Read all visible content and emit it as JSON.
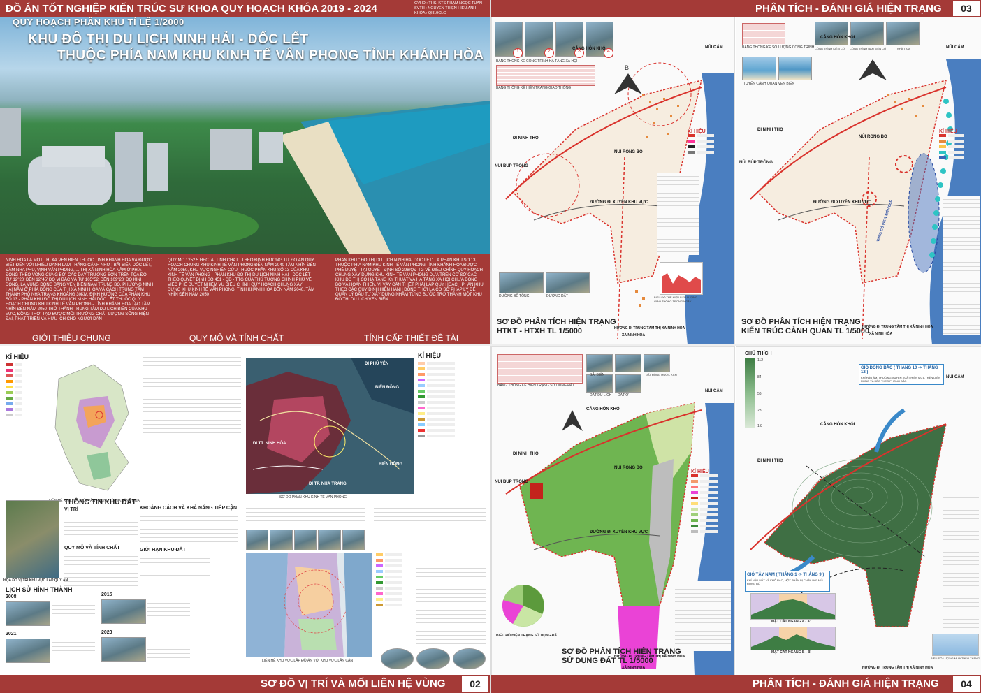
{
  "header": {
    "project_title": "ĐỒ ÁN TỐT NGHIỆP KIẾN TRÚC SƯ KHOA QUY HOẠCH KHÓA 2019 - 2024",
    "gvhd": "GVHD : THS. KTS PHẠM NGỌC TUẤN",
    "svth": "SVTH : NGUYỄN THIỆN HIẾU ANH",
    "khoa": "KHÓA : QH19CLC"
  },
  "sheet01": {
    "subtitle": "QUY HOẠCH PHÂN KHU TỈ LỆ 1/2000",
    "title_line1": "KHU ĐÔ THỊ DU LỊCH NINH HẢI - DỐC LẾT",
    "title_line2": "THUỘC PHÍA NAM KHU KINH TẾ VÂN PHONG TỈNH KHÁNH HÒA",
    "col1_text": "NINH HÒA LÀ MỘT THỊ XÃ VEN BIỂN THUỘC TỈNH KHÁNH HÒA VÀ ĐƯỢC BIẾT ĐẾN VỚI NHIỀU DANH LAM THẮNG CẢNH NHƯ : BÃI BIỂN DỐC LẾT, ĐẦM NHA PHU, VỊNH VÂN PHONG, ... THỊ XÃ NINH HÒA NẰM Ở PHÍA ĐÔNG THEO VÒNG CUNG BỞI CÁC DÃY TRƯỜNG SƠN TRÊN TỌA ĐỘ TỪ 12°20' ĐẾN 12°45' ĐỘ VĨ BẮC VÀ TỪ 105°52' ĐẾN 109°20' ĐỘ KINH ĐÔNG, LÀ VÙNG ĐỒNG BẰNG VEN BIỂN NAM TRUNG BỘ. PHƯỜNG NINH HẢI NẰM Ở PHÍA ĐÔNG CỦA THỊ XÃ NINH HÒA VÀ CÁCH TRUNG TÂM THÀNH PHỐ NHA TRANG KHOẢNG 30KM. ĐỊNH HƯỚNG CỦA PHÂN KHU SỐ 13 - PHÂN KHU ĐÔ THỊ DU LỊCH NINH HẢI DỐC LẾT THUỘC QUY HOẠCH CHUNG KHU KINH TẾ VÂN PHONG - TỈNH KHÁNH HÒA TẠO TẦM NHÌN ĐẾN NĂM 2050 TRỞ THÀNH TRUNG TÂM DU LỊCH BIỂN CỦA KHU VỰC, ĐỒNG THỜI TẠO ĐƯỢC MÔI TRƯỜNG CHẤT LƯỢNG SỐNG HIỆN ĐẠI, PHÁT TRIỂN VÀ HỮU ÍCH CHO NGƯỜI DÂN",
    "col2_text": "QUY MÔ : 252.5 HECTA. TÍNH CHẤT : THEO ĐỊNH HƯỚNG TỪ ĐỒ ÁN QUY HOẠCH CHUNG KHU KINH TẾ VÂN PHONG ĐẾN NĂM 2040 TẦM NHÌN ĐẾN NĂM 2050, KHU VỰC NGHIÊN CỨU THUỘC PHÂN KHU SỐ 13 CỦA KHU KINH TẾ VÂN PHONG - PHÂN KHU ĐÔ THỊ DU LỊCH NINH HẢI - DỐC LẾT THEO QUYẾT ĐỊNH SỐ 451 - QĐ - TTG CỦA THỦ TƯỚNG CHÍNH PHỦ VỀ VIỆC PHÊ DUYỆT NHIỆM VỤ ĐIỀU CHỈNH QUY HOẠCH CHUNG XÂY DỰNG KHU KINH TẾ VÂN PHONG, TỈNH KHÁNH HÒA ĐẾN NĂM 2040, TẦM NHÌN ĐẾN NĂM 2050",
    "col3_text": "PHÂN KHU \" ĐÔ THỊ DU LỊCH NINH HẢI DỐC LẾT\" LÀ PHÂN KHU SỐ 13 THUỘC PHÍA NAM KHU KINH TẾ VÂN PHONG TỈNH KHÁNH HÒA ĐƯỢC PHÊ DUYỆT TẠI QUYẾT ĐỊNH SỐ 298/QĐ-TG VỀ ĐIỀU CHỈNH QUY HOẠCH CHUNG XÂY DỰNG KHU KINH TẾ VÂN PHONG DỰA TRÊN CƠ SỞ CÁC KHU ĐÔ THỊ CÓ HẠ TẦNG KỸ THUẬT VÀ HẠ TẦNG XÃ HỘI CHƯA ĐỒNG BỘ VÀ HOÀN THIỆN, VÌ VẬY CẦN THIẾT PHẢI LẬP QUY HOẠCH PHÂN KHU THEO CÁC QUY ĐỊNH HIỆN HÀNH ĐỒNG THỜI LÀ CƠ SỞ PHÁP LÝ ĐỂ QUẢN LÝ ĐẦU TƯ XÂY DỰNG NHẰM TỪNG BƯỚC TRỞ THÀNH MỘT KHU ĐÔ THỊ DU LỊCH VEN BIỂN.",
    "label1": "GIỚI THIỆU CHUNG",
    "label2": "QUY MÔ VÀ TÍNH CHẤT",
    "label3": "TÍNH CẤP THIẾT ĐỀ TÀI"
  },
  "sheet02": {
    "footer_title": "SƠ ĐỒ VỊ TRÍ VÀ MỐI LIÊN HỆ VÙNG",
    "number": "02",
    "ki_hieu": "KÍ HIỆU",
    "caption_map1": "LIÊN HỆ KHU VỰC VỚI VÂN PHONG TỈNH KHÁNH HÒA",
    "caption_map2": "SƠ ĐỒ PHÂN KHU KINH TẾ VÂN PHONG",
    "caption_map3": "LIÊN HỆ KHU VỰC LẬP ĐỒ ÁN VỚI KHU VỰC LÂN CẬN",
    "thong_tin": "THÔNG TIN KHU ĐẤT",
    "vi_tri": "VỊ TRÍ",
    "quy_mo": "QUY MÔ VÀ TÍNH CHẤT",
    "khoang_cach": "KHOẢNG CÁCH VÀ KHẢ NĂNG TIẾP CẬN",
    "gioi_han": "GIỚI HẠN KHU ĐẤT",
    "hoa_do": "HỌA ĐỒ VỊ TRÍ KHU VỰC LẬP QUY ÁN",
    "lich_su": "LỊCH SỬ HÌNH THÀNH",
    "years": [
      "2008",
      "2015",
      "2021",
      "2023"
    ],
    "map_labels": [
      "ĐI PHÚ YÊN",
      "BIỂN ĐÔNG",
      "BIỂN ĐÔNG",
      "ĐI TT. NINH HÒA",
      "ĐI TP. NHA TRANG"
    ],
    "legend_ki_hieu2": "KÍ HIỆU"
  },
  "sheet03": {
    "header_title": "PHÂN TÍCH - ĐÁNH GIÁ HIỆN TRẠNG",
    "number": "03",
    "map1_title_l1": "SƠ ĐỒ PHÂN TÍCH HIỆN TRẠNG",
    "map1_title_l2": "HTKT - HTXH TL 1/5000",
    "map2_title_l1": "SƠ ĐỒ PHÂN TÍCH HIỆN TRẠNG",
    "map2_title_l2": "KIẾN TRÚC CẢNH QUAN TL 1/5000",
    "ki_hieu": "KÍ HIỆU",
    "labels": {
      "cang_hon_khoi": "CẢNG HÒN KHÓI",
      "nui_cam": "NÚI CẤM",
      "nui_rong_bo": "NÚI RONG BO",
      "di_ninh_tho": "ĐI NINH THỌ",
      "nui_bup_trong": "NÚI BÚP TRÒNG",
      "duong_di_xuyen": "ĐƯỜNG ĐI XUYÊN KHU VỰC",
      "huong_tt": "HƯỚNG ĐI TRUNG TÂM THỊ XÃ NINH HÒA",
      "xa_ninh_hoa": "XÃ NINH HÒA",
      "duong_be_tong": "ĐƯỜNG BÊ TÔNG",
      "duong_dat": "ĐƯỜNG ĐẤT",
      "vung_co_view": "VÙNG CÓ VIEW BIỂN ĐẸP",
      "tuyen_canh_quan": "TUYẾN CẢNH QUAN VEN BIỂN",
      "cong_trinh_kien_co": "CÔNG TRÌNH KIÊN CỐ",
      "cong_trinh_ban_kien_co": "CÔNG TRÌNH BÁN KIÊN CỐ",
      "nha_tam": "NHÀ TẠM",
      "bang_thong_ke_htkt": "BẢNG THỐNG KÊ CÔNG TRÌNH HẠ TẦNG XÃ HỘI",
      "bang_thong_ke_giao_thong": "BẢNG THỐNG KÊ HIỆN TRẠNG GIAO THÔNG",
      "bang_so_luong": "BẢNG THỐNG KÊ SỐ LƯỢNG CÔNG TRÌNH",
      "bieu_do_luu_luong": "BIỂU ĐỒ THỂ HIỆN LƯU LƯỢNG GIAO THÔNG TRONG NGÀY"
    },
    "photo_numbers": [
      "1",
      "2",
      "3",
      "4"
    ]
  },
  "sheet04": {
    "footer_title": "PHÂN TÍCH - ĐÁNH GIÁ HIỆN TRẠNG",
    "number": "04",
    "map1_title_l1": "SƠ ĐỒ PHÂN TÍCH HIỆN TRẠNG",
    "map1_title_l2": "SỬ DỤNG ĐẤT TL 1/5000",
    "ki_hieu": "KÍ HIỆU",
    "bang_thong_ke": "BẢNG THỐNG KÊ HIỆN TRẠNG SỬ DỤNG ĐẤT",
    "bieu_do": "BIỂU ĐỒ HIỆN TRẠNG SỬ DỤNG ĐẤT",
    "chu_thich": "CHÚ THÍCH",
    "scale_values": [
      "112",
      "84",
      "56",
      "28",
      "1.8"
    ],
    "gio_dong_bac": "GIÓ ĐÔNG BẮC ( THÁNG 10 -> THÁNG 12 )",
    "gio_dong_bac_sub": "KHÍ HẬU ẨM, THƯỜNG XUYÊN XUẤT HIỆN MƯA TRÊN DIỆN RỘNG VÀ KÉO THEO PHONG BÃO",
    "gio_tay_nam": "GIÓ TÂY NAM ( THÁNG 1 -> THÁNG 9 )",
    "gio_tay_nam_sub": "KHÍ HẬU MÁT VÀ KHÔ RÁO, MỘT PHẦN BỊ CHẮN BỞI NÚI RONG BÒ",
    "mat_cat_a": "MẶT CẮT NGANG A - A'",
    "mat_cat_b": "MẶT CẮT NGANG B - B'",
    "bieu_do_mua": "BIỂU ĐỒ LƯỢNG MƯA THEO THÁNG",
    "labels": {
      "cang_hon_khoi": "CẢNG HÒN KHÓI",
      "nui_cam": "NÚI CẤM",
      "nui_rong_bo": "NÚI RONG BO",
      "di_ninh_tho": "ĐI NINH THỌ",
      "nui_bup_trong": "NÚI BÚP TRÒNG",
      "duong_di_xuyen": "ĐƯỜNG ĐI XUYÊN KHU VỰC",
      "huong_tt": "HƯỚNG ĐI TRUNG TÂM THỊ XÃ NINH HÒA",
      "xa_ninh_hoa": "XÃ NINH HÒA",
      "bai_bien": "BÃI BIỂN",
      "dat_du_lich": "ĐẤT DU LỊCH",
      "dat_o": "ĐẤT Ở",
      "dat_dong_muoi": "ĐẤT ĐỒNG MUỐI - KCN"
    }
  },
  "colors": {
    "brand_red": "#a43a37",
    "map_green": "#5fa84a",
    "road_red": "#d9322c",
    "sea_blue": "#4a7ec0"
  }
}
